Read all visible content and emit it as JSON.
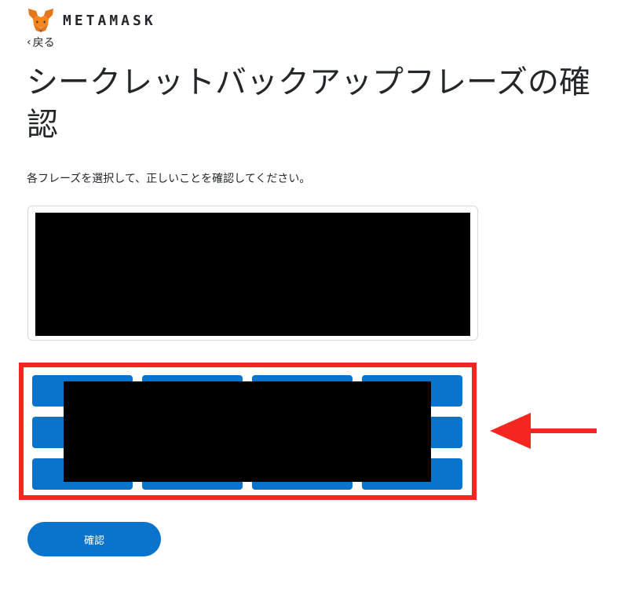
{
  "header": {
    "wordmark": "METAMASK",
    "logo_icon": "metamask-fox-icon"
  },
  "nav": {
    "back_label": "戻る",
    "back_icon": "chevron-left-icon"
  },
  "main": {
    "title": "シークレットバックアップフレーズの確認",
    "instruction": "各フレーズを選択して、正しいことを確認してください。",
    "confirm_label": "確認",
    "word_grid": {
      "rows": 3,
      "columns": 4
    }
  },
  "annotation": {
    "highlight_color": "#f4261f",
    "arrow_icon": "left-arrow-icon"
  },
  "colors": {
    "accent": "#0a73cc",
    "text": "#24272a",
    "border": "#d6d9dc",
    "annotation": "#f4261f"
  }
}
